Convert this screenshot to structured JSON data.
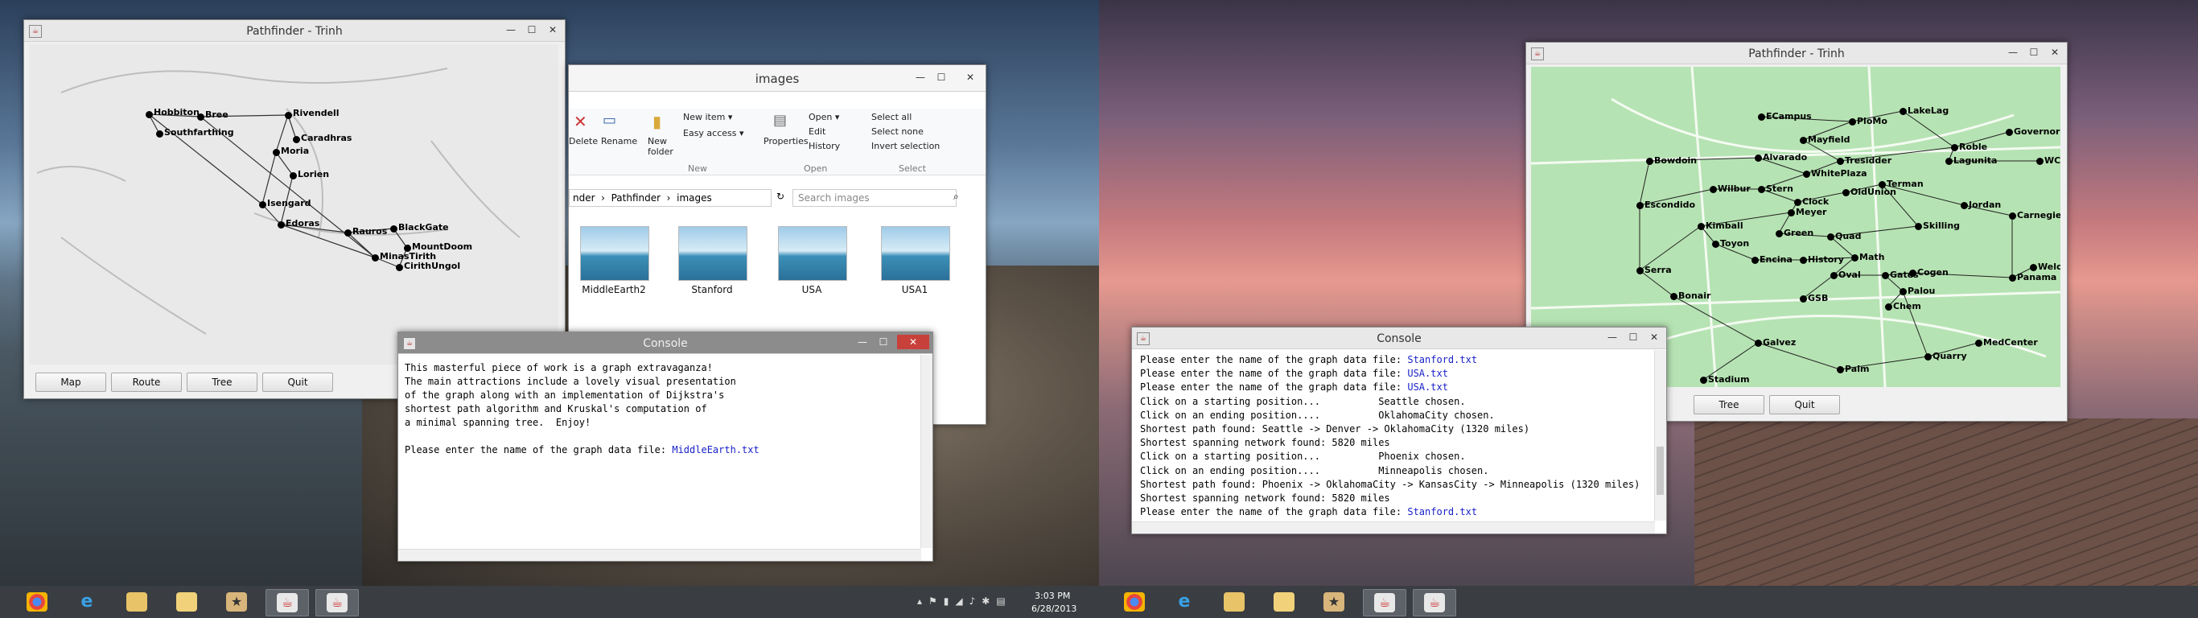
{
  "left_screen": {
    "pathfinder": {
      "title": "Pathfinder - Trinh",
      "buttons": [
        "Map",
        "Route",
        "Tree",
        "Quit"
      ],
      "nodes": [
        {
          "name": "Hobbiton"
        },
        {
          "name": "Bree"
        },
        {
          "name": "Rivendell"
        },
        {
          "name": "Southfarthing"
        },
        {
          "name": "Caradhras"
        },
        {
          "name": "Moria"
        },
        {
          "name": "Lorien"
        },
        {
          "name": "Isengard"
        },
        {
          "name": "Edoras"
        },
        {
          "name": "Rauros"
        },
        {
          "name": "BlackGate"
        },
        {
          "name": "MountDoom"
        },
        {
          "name": "MinasTirith"
        },
        {
          "name": "CirithUngol"
        }
      ]
    },
    "explorer": {
      "title": "images",
      "ribbon": {
        "delete": "Delete",
        "rename": "Rename",
        "new_folder": "New\nfolder",
        "new_item": "New item ▾",
        "easy_access": "Easy access ▾",
        "group_new": "New",
        "properties": "Properties",
        "open": "Open ▾",
        "edit": "Edit",
        "history": "History",
        "group_open": "Open",
        "select_all": "Select all",
        "select_none": "Select none",
        "invert_selection": "Invert selection",
        "group_select": "Select"
      },
      "breadcrumb": "nder  ›  Pathfinder  ›  images",
      "search_placeholder": "Search images",
      "files": [
        "MiddleEarth2",
        "Stanford",
        "USA",
        "USA1"
      ]
    },
    "console": {
      "title": "Console",
      "text": "This masterful piece of work is a graph extravaganza!\nThe main attractions include a lovely visual presentation\nof the graph along with an implementation of Dijkstra's\nshortest path algorithm and Kruskal's computation of\na minimal spanning tree.  Enjoy!\n\nPlease enter the name of the graph data file: ",
      "input": "MiddleEarth.txt"
    }
  },
  "right_screen": {
    "pathfinder": {
      "title": "Pathfinder - Trinh",
      "buttons": [
        "Tree",
        "Quit"
      ],
      "nodes": [
        {
          "name": "ECampus"
        },
        {
          "name": "PloMo"
        },
        {
          "name": "LakeLag"
        },
        {
          "name": "GovernorsCorr"
        },
        {
          "name": "Mayfield"
        },
        {
          "name": "Roble"
        },
        {
          "name": "Bowdoin"
        },
        {
          "name": "Alvarado"
        },
        {
          "name": "Tresidder"
        },
        {
          "name": "Lagunita"
        },
        {
          "name": "WCampus"
        },
        {
          "name": "WhitePlaza"
        },
        {
          "name": "Escondido"
        },
        {
          "name": "Wilbur"
        },
        {
          "name": "Stern"
        },
        {
          "name": "OldUnion"
        },
        {
          "name": "Terman"
        },
        {
          "name": "Clock"
        },
        {
          "name": "Meyer"
        },
        {
          "name": "Jordan"
        },
        {
          "name": "Carnegie"
        },
        {
          "name": "Kimball"
        },
        {
          "name": "Skilling"
        },
        {
          "name": "Green"
        },
        {
          "name": "Quad"
        },
        {
          "name": "Toyon"
        },
        {
          "name": "Math"
        },
        {
          "name": "Encina"
        },
        {
          "name": "History"
        },
        {
          "name": "Welch"
        },
        {
          "name": "Serra"
        },
        {
          "name": "Oval"
        },
        {
          "name": "Gates"
        },
        {
          "name": "Cogen"
        },
        {
          "name": "Panama"
        },
        {
          "name": "Bonair"
        },
        {
          "name": "GSB"
        },
        {
          "name": "Palou"
        },
        {
          "name": "Chem"
        },
        {
          "name": "MedCenter"
        },
        {
          "name": "Galvez"
        },
        {
          "name": "Quarry"
        },
        {
          "name": "Palm"
        },
        {
          "name": "Stadium"
        }
      ]
    },
    "console": {
      "title": "Console",
      "lines": [
        {
          "text": "Please enter the name of the graph data file: ",
          "val": "Stanford.txt"
        },
        {
          "text": "Please enter the name of the graph data file: ",
          "val": "USA.txt"
        },
        {
          "text": "Please enter the name of the graph data file: ",
          "val": "USA.txt"
        },
        {
          "text": "Click on a starting position...          Seattle chosen.",
          "val": ""
        },
        {
          "text": "Click on an ending position....          OklahomaCity chosen.",
          "val": ""
        },
        {
          "text": "Shortest path found: Seattle -> Denver -> OklahomaCity (1320 miles)",
          "val": ""
        },
        {
          "text": "Shortest spanning network found: 5820 miles",
          "val": ""
        },
        {
          "text": "Click on a starting position...          Phoenix chosen.",
          "val": ""
        },
        {
          "text": "Click on an ending position....          Minneapolis chosen.",
          "val": ""
        },
        {
          "text": "Shortest path found: Phoenix -> OklahomaCity -> KansasCity -> Minneapolis (1320 miles)",
          "val": ""
        },
        {
          "text": "Shortest spanning network found: 5820 miles",
          "val": ""
        },
        {
          "text": "Please enter the name of the graph data file: ",
          "val": "Stanford.txt"
        }
      ]
    }
  },
  "taskbar": {
    "time": "3:03 PM",
    "date": "6/28/2013",
    "apps": [
      "chrome-icon",
      "ie-icon",
      "explorer-icon",
      "folder-icon",
      "photos-icon",
      "java-icon",
      "java-icon"
    ]
  },
  "colors": {
    "console_input": "#1a22c8",
    "map_bg_right": "#b6e3b3",
    "taskbar": "#3a3d41"
  }
}
